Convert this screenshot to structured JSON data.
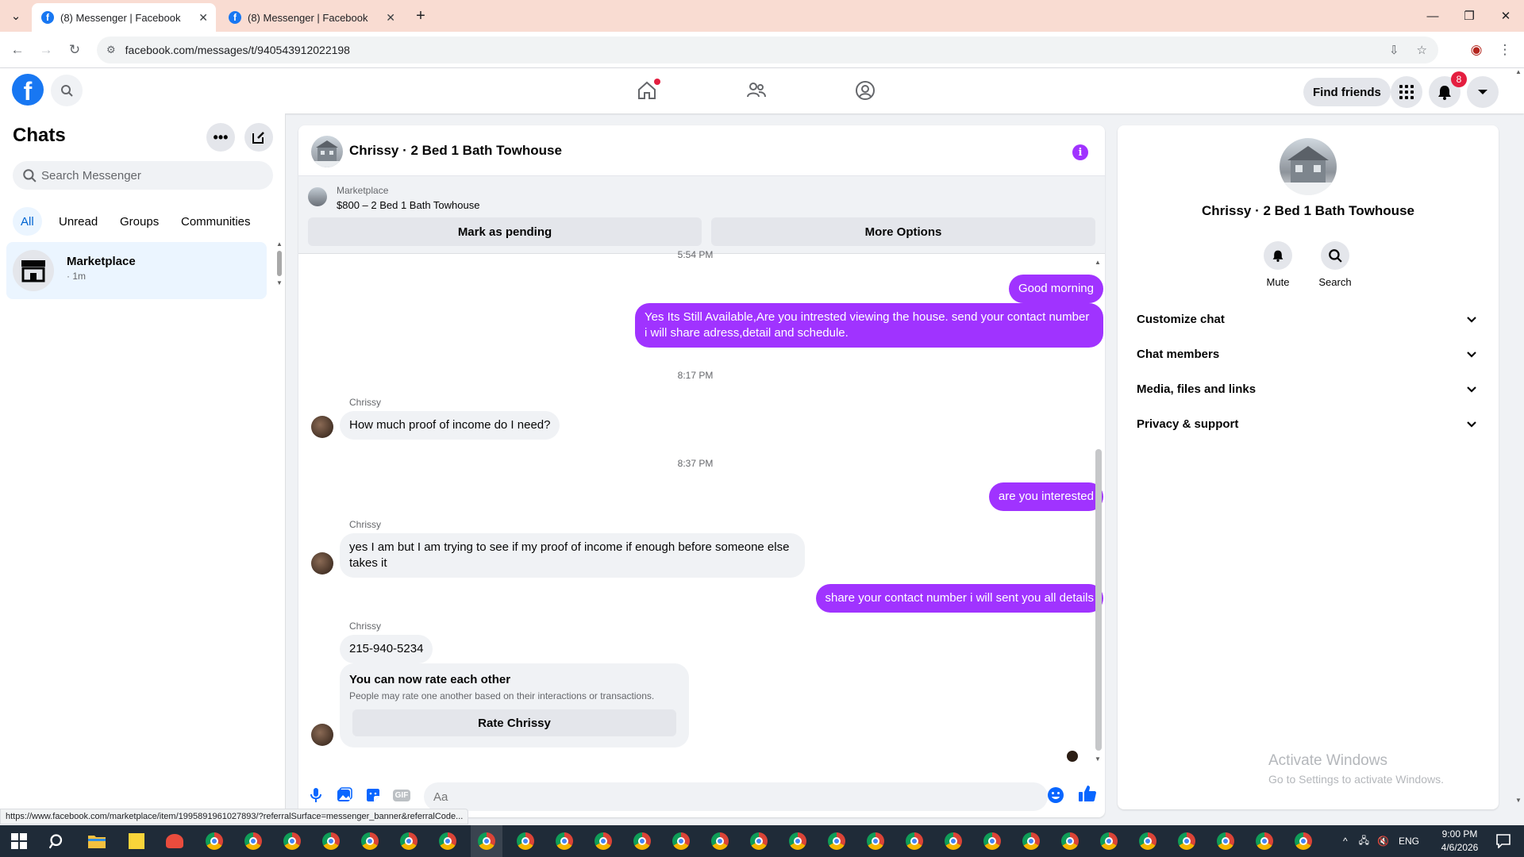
{
  "browser": {
    "tabs": [
      {
        "title": "(8) Messenger | Facebook",
        "active": true
      },
      {
        "title": "(8) Messenger | Facebook",
        "active": false
      }
    ],
    "url": "facebook.com/messages/t/940543912022198",
    "status_url": "https://www.facebook.com/marketplace/item/1995891961027893/?referralSurface=messenger_banner&referralCode..."
  },
  "fb_header": {
    "logo_letter": "f",
    "find_friends_label": "Find friends",
    "notification_count": "8"
  },
  "chats_panel": {
    "title": "Chats",
    "search_placeholder": "Search Messenger",
    "filters": [
      "All",
      "Unread",
      "Groups",
      "Communities"
    ],
    "items": [
      {
        "name": "Marketplace",
        "meta": "· 1m"
      }
    ]
  },
  "conversation": {
    "title": "Chrissy · 2 Bed 1 Bath Towhouse",
    "marketplace_label": "Marketplace",
    "listing": "$800 – 2 Bed 1 Bath Towhouse",
    "mark_pending_label": "Mark as pending",
    "more_options_label": "More Options",
    "messages": {
      "t1": "5:54 PM",
      "m1": "Good morning",
      "m2": "Yes Its Still Available,Are you intrested viewing the house. send your contact number i will share adress,detail and schedule.",
      "t2": "8:17 PM",
      "s1": "Chrissy",
      "m3": "How much proof of income do I need?",
      "t3": "8:37 PM",
      "m4": "are you interested",
      "s2": "Chrissy",
      "m5": "yes I am but I am trying to see if my proof of income if enough before someone else takes it",
      "m6": "share your contact number i will sent you all details",
      "s3": "Chrissy",
      "m7": "215-940-5234"
    },
    "rate_card": {
      "title": "You can now rate each other",
      "subtitle": "People may rate one another based on their interactions or transactions.",
      "button_label": "Rate Chrissy"
    },
    "composer_placeholder": "Aa",
    "gif_label": "GIF"
  },
  "info_panel": {
    "name": "Chrissy · 2 Bed 1 Bath Towhouse",
    "actions": [
      "Mute",
      "Search"
    ],
    "sections": [
      "Customize chat",
      "Chat members",
      "Media, files and links",
      "Privacy & support"
    ]
  },
  "watermark": {
    "line1": "Activate Windows",
    "line2": "Go to Settings to activate Windows."
  },
  "taskbar": {
    "language": "ENG",
    "time": "9:00 PM",
    "date": "4/6/2026"
  },
  "colors": {
    "fb_blue": "#1877f2",
    "bubble_purple": "#a033ff",
    "badge_red": "#e41e3f",
    "tab_bar": "#f9dcd2"
  }
}
